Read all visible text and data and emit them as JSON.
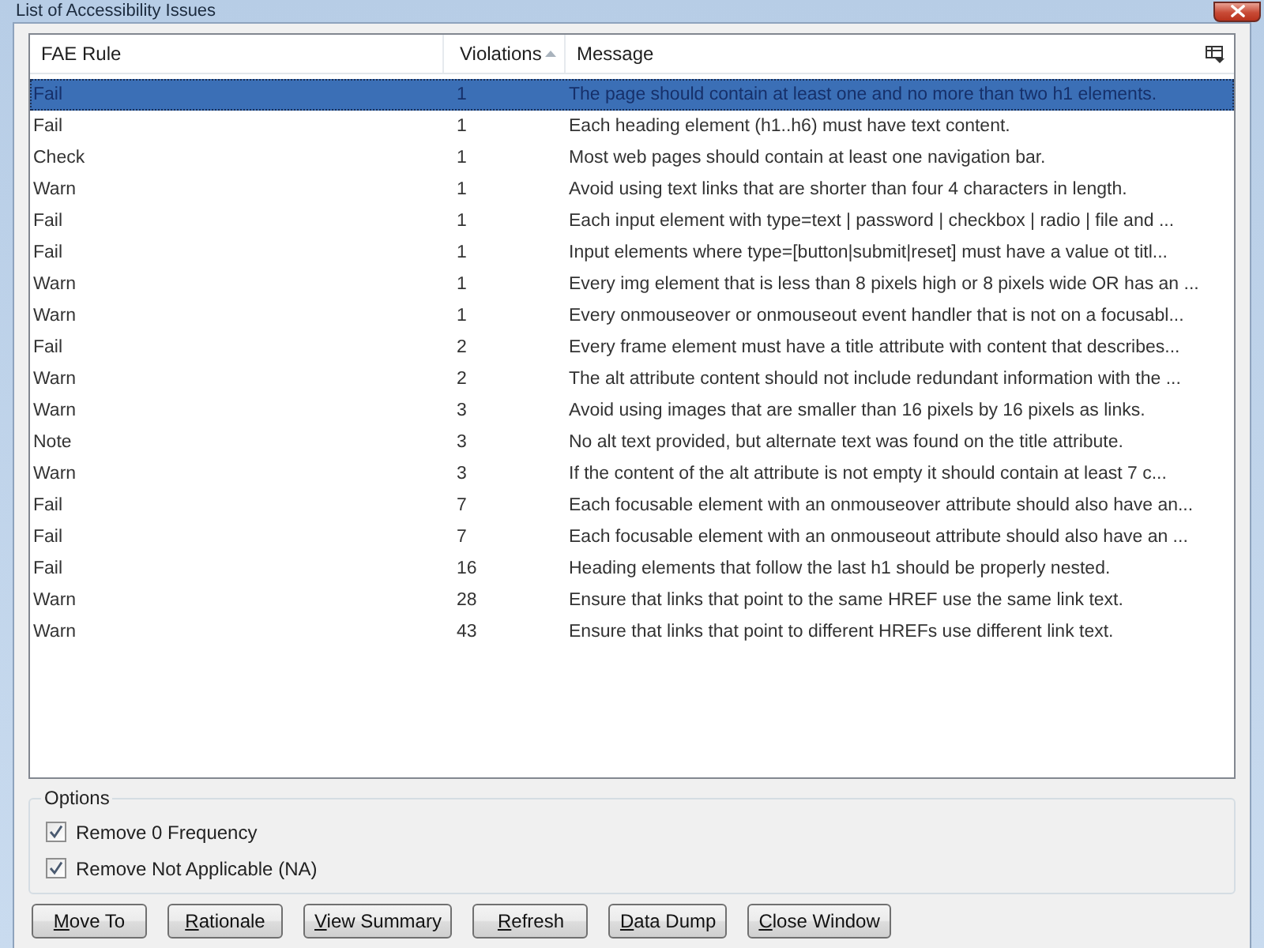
{
  "window": {
    "title": "List of Accessibility Issues"
  },
  "table": {
    "columns": [
      {
        "label": "FAE Rule",
        "sorted": false
      },
      {
        "label": "Violations",
        "sorted": true
      },
      {
        "label": "Message",
        "sorted": false
      }
    ],
    "rows": [
      {
        "rule": "Fail",
        "violations": "1",
        "message": "The page should contain at least one and no more than two h1 elements.",
        "selected": true
      },
      {
        "rule": "Fail",
        "violations": "1",
        "message": "Each heading element (h1..h6) must have text content.",
        "selected": false
      },
      {
        "rule": "Check",
        "violations": "1",
        "message": "Most web pages should contain at least one navigation bar.",
        "selected": false
      },
      {
        "rule": "Warn",
        "violations": "1",
        "message": "Avoid using text links that are shorter than four 4 characters in length.",
        "selected": false
      },
      {
        "rule": "Fail",
        "violations": "1",
        "message": "Each input element with type=text | password | checkbox | radio | file and ...",
        "selected": false
      },
      {
        "rule": "Fail",
        "violations": "1",
        "message": "Input elements where type=[button|submit|reset] must have a value ot titl...",
        "selected": false
      },
      {
        "rule": "Warn",
        "violations": "1",
        "message": "Every img element that is less than 8 pixels high or 8 pixels wide OR has an ...",
        "selected": false
      },
      {
        "rule": "Warn",
        "violations": "1",
        "message": "Every onmouseover or onmouseout event handler that is not on a focusabl...",
        "selected": false
      },
      {
        "rule": "Fail",
        "violations": "2",
        "message": "Every frame element must have a title attribute with content that describes...",
        "selected": false
      },
      {
        "rule": "Warn",
        "violations": "2",
        "message": "The alt attribute content should not include redundant information with the ...",
        "selected": false
      },
      {
        "rule": "Warn",
        "violations": "3",
        "message": "Avoid using images that are smaller than 16 pixels by 16 pixels as links.",
        "selected": false
      },
      {
        "rule": "Note",
        "violations": "3",
        "message": "No alt text provided, but alternate text was found on the title attribute.",
        "selected": false
      },
      {
        "rule": "Warn",
        "violations": "3",
        "message": "If the content of the alt attribute is not empty it should contain at least 7 c...",
        "selected": false
      },
      {
        "rule": "Fail",
        "violations": "7",
        "message": "Each focusable element with an onmouseover attribute should also have an...",
        "selected": false
      },
      {
        "rule": "Fail",
        "violations": "7",
        "message": "Each focusable element with an onmouseout attribute should also have an ...",
        "selected": false
      },
      {
        "rule": "Fail",
        "violations": "16",
        "message": "Heading elements that follow the last h1 should be properly nested.",
        "selected": false
      },
      {
        "rule": "Warn",
        "violations": "28",
        "message": "Ensure that links that point to the same HREF use the same link text.",
        "selected": false
      },
      {
        "rule": "Warn",
        "violations": "43",
        "message": "Ensure that links that point to different HREFs use different link text.",
        "selected": false
      }
    ]
  },
  "options": {
    "title": "Options",
    "items": [
      {
        "label": "Remove 0 Frequency",
        "checked": true
      },
      {
        "label": "Remove Not Applicable (NA)",
        "checked": true
      }
    ]
  },
  "buttons": [
    "Move To",
    "Rationale",
    "View Summary",
    "Refresh",
    "Data Dump",
    "Close Window"
  ]
}
